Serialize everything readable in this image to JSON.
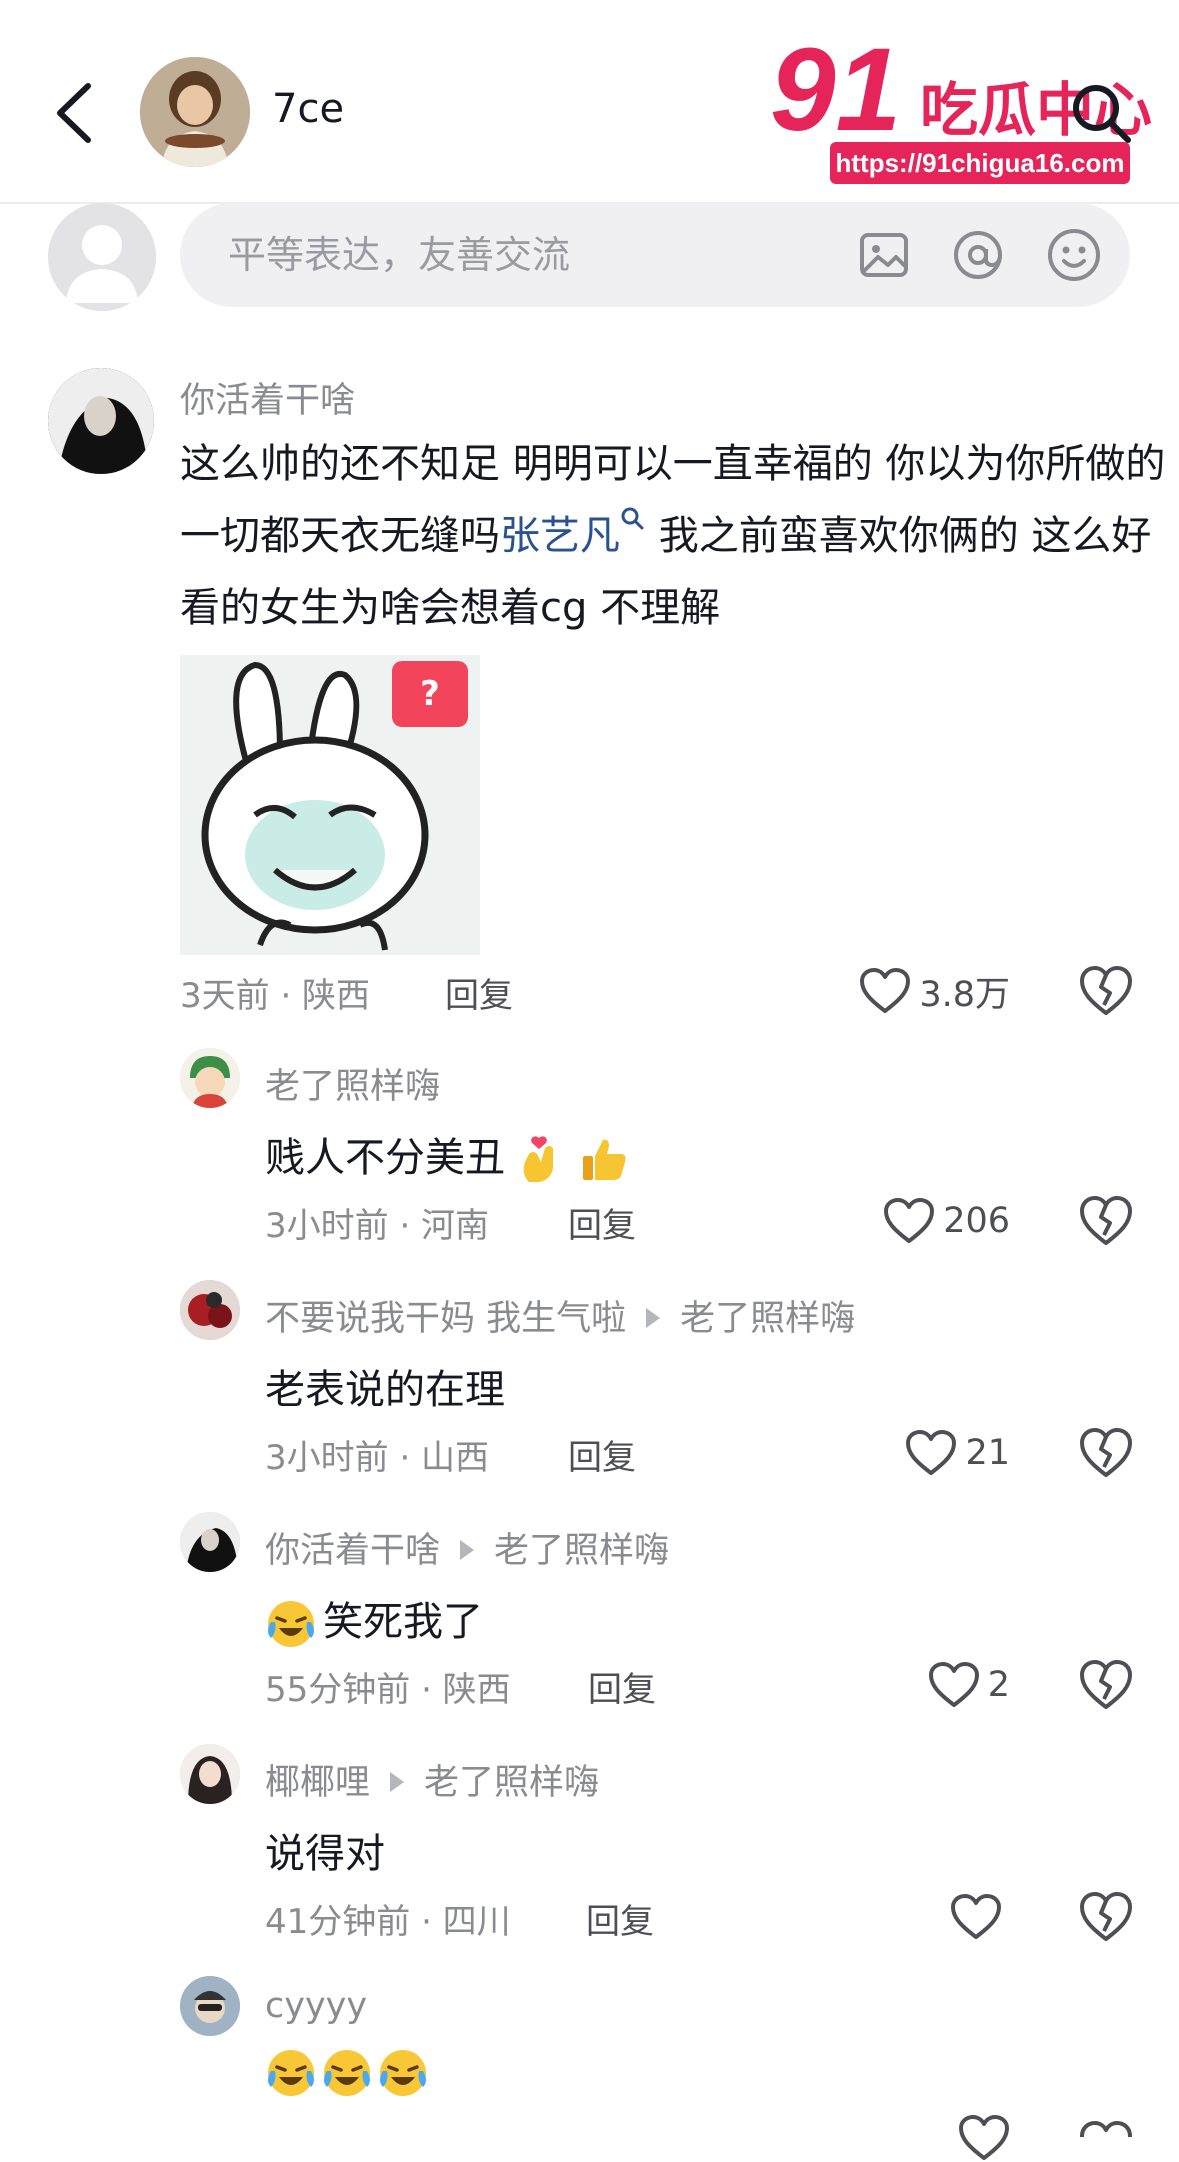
{
  "header": {
    "username": "7ce",
    "watermark_number": "91",
    "watermark_brand": "吃瓜中心",
    "watermark_url": "https://91chigua16.com"
  },
  "composer": {
    "placeholder": "平等表达，友善交流"
  },
  "comments": [
    {
      "author": "你活着干啥",
      "text_before": "这么帅的还不知足 明明可以一直幸福的 你以为你所做的一切都天衣无缝吗",
      "mention": "张艺凡",
      "text_after": " 我之前蛮喜欢你俩的 这么好看的女生为啥会想着cg 不理解",
      "sticker_badge": "?",
      "time": "3天前 · 陕西",
      "reply_label": "回复",
      "likes": "3.8万"
    }
  ],
  "replies": [
    {
      "author": "老了照样嗨",
      "reply_to": "",
      "text": "贱人不分美丑",
      "emojis_after": [
        "finger-heart",
        "thumbs-up"
      ],
      "time": "3小时前 · 河南",
      "reply_label": "回复",
      "likes": "206"
    },
    {
      "author": "不要说我干妈 我生气啦",
      "reply_to": "老了照样嗨",
      "text": "老表说的在理",
      "time": "3小时前 · 山西",
      "reply_label": "回复",
      "likes": "21"
    },
    {
      "author": "你活着干啥",
      "reply_to": "老了照样嗨",
      "text": "笑死我了",
      "emojis_before": [
        "crying-laughing"
      ],
      "time": "55分钟前 · 陕西",
      "reply_label": "回复",
      "likes": "2"
    },
    {
      "author": "椰椰哩",
      "reply_to": "老了照样嗨",
      "text": "说得对",
      "time": "41分钟前 · 四川",
      "reply_label": "回复",
      "likes": ""
    },
    {
      "author": "cyyyy",
      "reply_to": "",
      "text": "",
      "emojis_before": [
        "crying-laughing",
        "crying-laughing",
        "crying-laughing"
      ]
    }
  ],
  "colors": {
    "mention": "#2b5290",
    "secondary_text": "#8a8b91",
    "watermark_pink": "#e5245a"
  }
}
